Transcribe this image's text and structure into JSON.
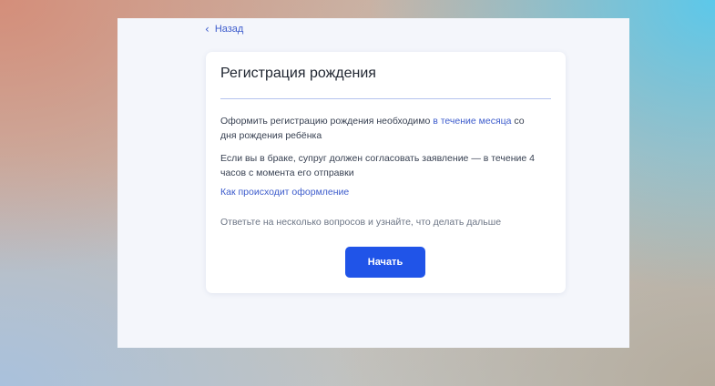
{
  "nav": {
    "back_label": "Назад"
  },
  "card": {
    "title": "Регистрация рождения",
    "paragraph1": {
      "before": "Оформить регистрацию рождения необходимо ",
      "link": "в течение месяца",
      "after": " со дня рождения ребёнка"
    },
    "paragraph2": "Если вы в браке, супруг должен согласовать заявление — в течение 4 часов с момента его отправки",
    "how_link": "Как происходит оформление",
    "hint": "Ответьте на несколько вопросов и узнайте, что делать дальше",
    "start_button": "Начать"
  },
  "colors": {
    "accent": "#2054e8",
    "link": "#3d5ccc",
    "divider": "#b4c3ee",
    "page_bg": "#f4f6fb"
  }
}
